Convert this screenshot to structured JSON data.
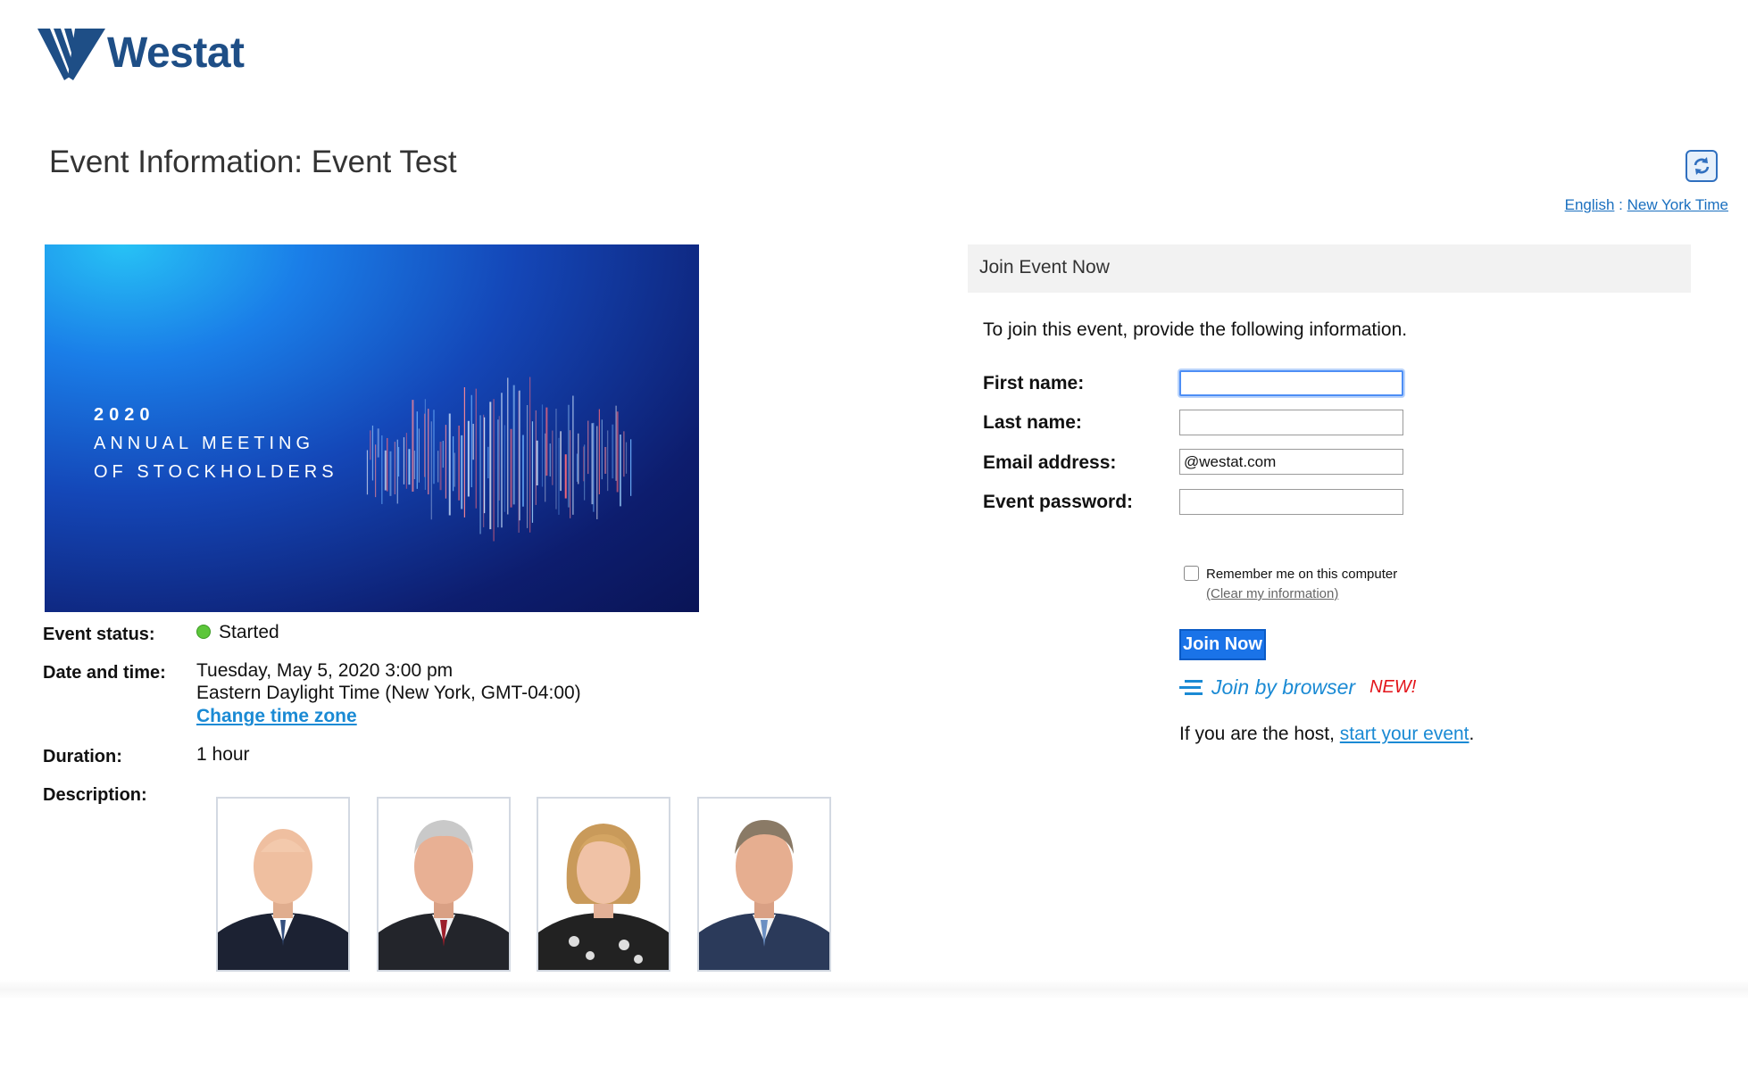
{
  "brand": {
    "name": "Westat",
    "color": "#1e4e86"
  },
  "page": {
    "title": "Event Information: Event Test"
  },
  "locale": {
    "language": "English",
    "separator": ":",
    "timezone": "New York Time"
  },
  "banner": {
    "line1": "2020",
    "line2": "ANNUAL MEETING",
    "line3": "OF STOCKHOLDERS"
  },
  "details": {
    "status_label": "Event status:",
    "status_value": "Started",
    "datetime_label": "Date and time:",
    "datetime_line1": "Tuesday, May 5, 2020 3:00 pm",
    "datetime_line2": "Eastern Daylight Time (New York, GMT-04:00)",
    "change_tz": "Change time zone",
    "duration_label": "Duration:",
    "duration_value": "1 hour",
    "description_label": "Description:"
  },
  "photos": [
    {
      "icon": "person-photo"
    },
    {
      "icon": "person-photo"
    },
    {
      "icon": "person-photo"
    },
    {
      "icon": "person-photo"
    }
  ],
  "join": {
    "header": "Join Event Now",
    "intro": "To join this event, provide the following information.",
    "first_name_label": "First name:",
    "first_name_value": "",
    "last_name_label": "Last name:",
    "last_name_value": "",
    "email_label": "Email address:",
    "email_value": "@westat.com",
    "password_label": "Event password:",
    "password_value": "",
    "remember_label": "Remember me on this computer",
    "clear_info": "(Clear my information)",
    "join_now": "Join Now",
    "join_browser": "Join by browser",
    "new_badge": "NEW!",
    "host_prefix": "If you are the host,",
    "host_link": "start your event",
    "host_suffix": "."
  },
  "colors": {
    "accent": "#1a8ad4",
    "button": "#1a73e8",
    "status_green": "#5cc63a",
    "new_red": "#e3141a"
  }
}
